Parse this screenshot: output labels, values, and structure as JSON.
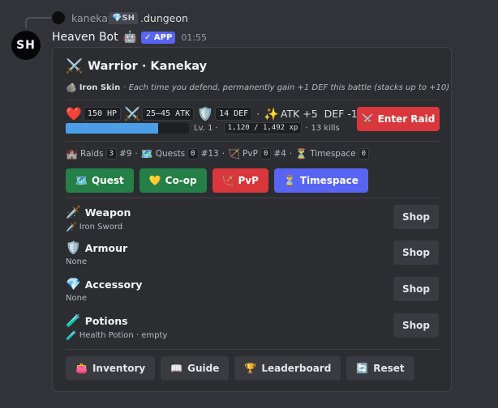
{
  "reply": {
    "username": "kanekay",
    "tag": "💎SH",
    "command": ".dungeon"
  },
  "message": {
    "avatar_initials": "SH",
    "author": "Heaven Bot",
    "bot_icon": "🤖",
    "badge": "✓ APP",
    "timestamp": "01:55"
  },
  "embed": {
    "title_icon": "⚔️",
    "title": "Warrior · Kanekay",
    "skill": {
      "icon": "🪨",
      "name": "Iron Skin",
      "description": "· Each time you defend, permanently gain +1 DEF this battle (stacks up to +10)"
    },
    "stats": {
      "hp_icon": "❤️",
      "hp": "150 HP",
      "atk_icon": "⚔️",
      "atk": "25–45 ATK",
      "def_icon": "🛡️",
      "def": "14 DEF",
      "sep": "·",
      "buff_icon": "✨",
      "buff": "ATK +5  DEF -1"
    },
    "xp": {
      "progress": 0.751,
      "level": "Lv. 1",
      "dot": "·",
      "xp_text": "1,120 / 1,492 xp",
      "kills": "13 kills"
    },
    "raid_button": {
      "icon": "⚔️",
      "label": "Enter Raid"
    },
    "progress": {
      "raids_icon": "🏰",
      "raids_label": "Raids",
      "raids_count": "3",
      "raids_rank": "#9",
      "quests_icon": "🗺️",
      "quests_label": "Quests",
      "quests_count": "0",
      "quests_rank": "#13",
      "pvp_icon": "🏹",
      "pvp_label": "PvP",
      "pvp_count": "0",
      "pvp_rank": "#4",
      "timespace_icon": "⏳",
      "timespace_label": "Timespace",
      "timespace_count": "0",
      "sep": "·"
    },
    "modes": [
      {
        "icon": "🗺️",
        "label": "Quest",
        "color": "#248046"
      },
      {
        "icon": "💛",
        "label": "Co-op",
        "color": "#248046"
      },
      {
        "icon": "🏹",
        "label": "PvP",
        "color": "#da373c"
      },
      {
        "icon": "⏳",
        "label": "Timespace",
        "color": "#5865f2"
      }
    ],
    "equipment": [
      {
        "icon": "🗡️",
        "name": "Weapon",
        "sub_icon": "🗡️",
        "sub": "Iron Sword",
        "shop": "Shop"
      },
      {
        "icon": "🛡️",
        "name": "Armour",
        "sub_icon": "",
        "sub": "None",
        "shop": "Shop"
      },
      {
        "icon": "💎",
        "name": "Accessory",
        "sub_icon": "",
        "sub": "None",
        "shop": "Shop"
      },
      {
        "icon": "🧪",
        "name": "Potions",
        "sub_icon": "🧪",
        "sub": "Health Potion · empty",
        "shop": "Shop"
      }
    ],
    "actions": [
      {
        "icon": "👛",
        "label": "Inventory"
      },
      {
        "icon": "📖",
        "label": "Guide"
      },
      {
        "icon": "🏆",
        "label": "Leaderboard"
      },
      {
        "icon": "🔄",
        "label": "Reset"
      }
    ]
  }
}
